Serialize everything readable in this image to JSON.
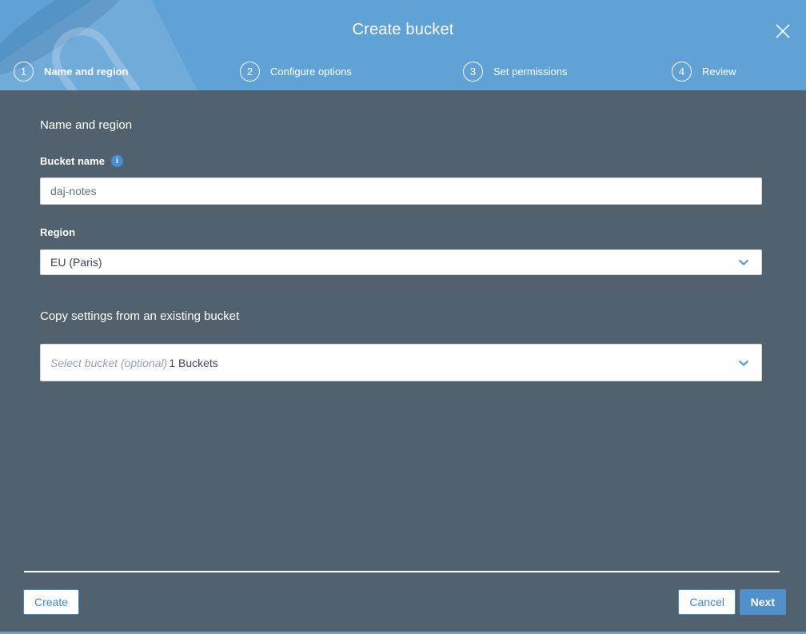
{
  "modal": {
    "title": "Create bucket",
    "close_icon": "x-close"
  },
  "steps": [
    {
      "number": "1",
      "label": "Name and region",
      "active": true
    },
    {
      "number": "2",
      "label": "Configure options",
      "active": false
    },
    {
      "number": "3",
      "label": "Set permissions",
      "active": false
    },
    {
      "number": "4",
      "label": "Review",
      "active": false
    }
  ],
  "form": {
    "section_heading": "Name and region",
    "bucket_name": {
      "label": "Bucket name",
      "info_icon": "i",
      "value": "daj-notes"
    },
    "region": {
      "label": "Region",
      "selected": "EU (Paris)"
    },
    "copy_settings": {
      "heading": "Copy settings from an existing bucket",
      "placeholder": "Select bucket (optional)",
      "bucket_count": "1 Buckets"
    }
  },
  "footer": {
    "create_label": "Create",
    "cancel_label": "Cancel",
    "next_label": "Next"
  },
  "colors": {
    "header_blue": "#60A2D6",
    "body_slate": "#52616E",
    "accent_blue": "#4489C8",
    "next_button_blue": "#5190CB",
    "white": "#FFFFFF"
  }
}
